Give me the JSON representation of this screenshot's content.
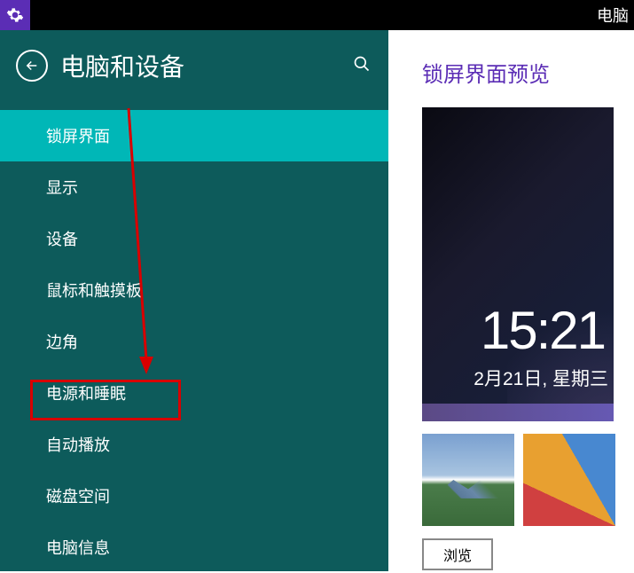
{
  "topbar": {
    "title_partial": "电脑"
  },
  "sidebar": {
    "title": "电脑和设备",
    "items": [
      {
        "label": "锁屏界面"
      },
      {
        "label": "显示"
      },
      {
        "label": "设备"
      },
      {
        "label": "鼠标和触摸板"
      },
      {
        "label": "边角"
      },
      {
        "label": "电源和睡眠"
      },
      {
        "label": "自动播放"
      },
      {
        "label": "磁盘空间"
      },
      {
        "label": "电脑信息"
      }
    ],
    "active_index": 0,
    "highlighted_index": 5
  },
  "content": {
    "title": "锁屏界面预览",
    "preview": {
      "time": "15:21",
      "date": "2月21日, 星期三"
    },
    "browse_label": "浏览"
  },
  "annotation": {
    "arrow_color": "#d80000",
    "box_target": "电源和睡眠"
  }
}
